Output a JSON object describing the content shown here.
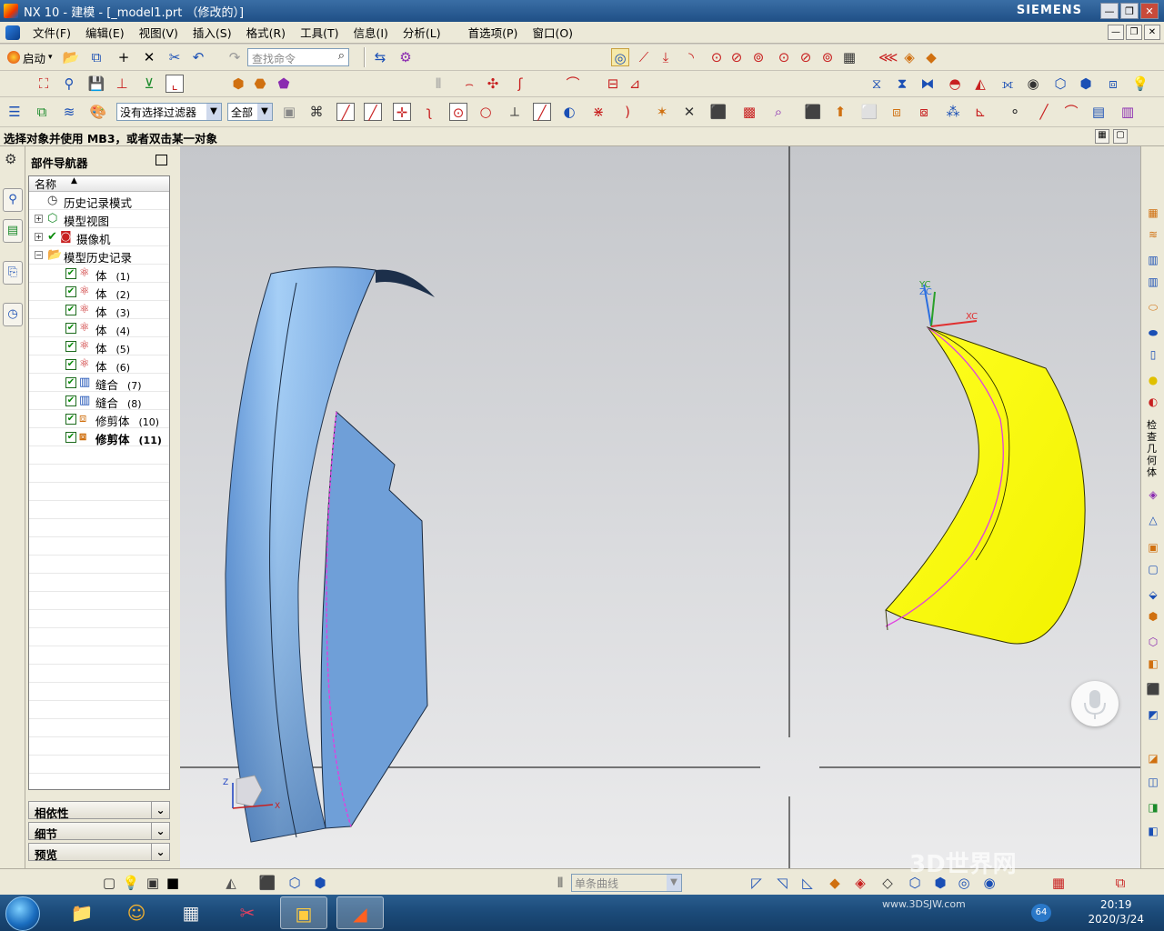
{
  "window": {
    "title": "NX 10 - 建模 - [_model1.prt （修改的）]",
    "brand": "SIEMENS"
  },
  "menu": {
    "items": [
      "文件(F)",
      "编辑(E)",
      "视图(V)",
      "插入(S)",
      "格式(R)",
      "工具(T)",
      "信息(I)",
      "分析(L)",
      "首选项(P)",
      "窗口(O)"
    ]
  },
  "toolbar": {
    "start_label": "启动",
    "search_placeholder": "查找命令",
    "filter_value": "没有选择过滤器",
    "scope_value": "全部"
  },
  "status": {
    "prompt": "选择对象并使用 MB3，或者双击某一对象"
  },
  "navigator": {
    "title": "部件导航器",
    "column_name": "名称",
    "nodes": [
      {
        "label": "历史记录模式",
        "num": ""
      },
      {
        "label": "模型视图",
        "num": ""
      },
      {
        "label": "摄像机",
        "num": ""
      },
      {
        "label": "模型历史记录",
        "num": ""
      },
      {
        "label": "体",
        "num": "(1)"
      },
      {
        "label": "体",
        "num": "(2)"
      },
      {
        "label": "体",
        "num": "(3)"
      },
      {
        "label": "体",
        "num": "(4)"
      },
      {
        "label": "体",
        "num": "(5)"
      },
      {
        "label": "体",
        "num": "(6)"
      },
      {
        "label": "缝合",
        "num": "(7)"
      },
      {
        "label": "缝合",
        "num": "(8)"
      },
      {
        "label": "修剪体",
        "num": "(10)"
      },
      {
        "label": "修剪体",
        "num": "(11)"
      }
    ],
    "sections": [
      "相依性",
      "细节",
      "预览"
    ]
  },
  "viewport": {
    "left_axes": {
      "x": "X",
      "z": "Z"
    },
    "right_axes": {
      "xc": "XC",
      "yc": "YC",
      "zc": "ZC"
    }
  },
  "rightbar": {
    "label": "检查几何体"
  },
  "bottombar": {
    "curve_filter": "单条曲线"
  },
  "taskbar": {
    "time": "20:19",
    "date": "2020/3/24",
    "badge": "64"
  },
  "watermark": {
    "text": "3D世界网",
    "url": "www.3DSJW.com"
  },
  "colors": {
    "surface_blue": "#7aaee6",
    "surface_yellow": "#ffff00",
    "edge_magenta": "#e040e0",
    "titlebar": "#2a5e96"
  }
}
